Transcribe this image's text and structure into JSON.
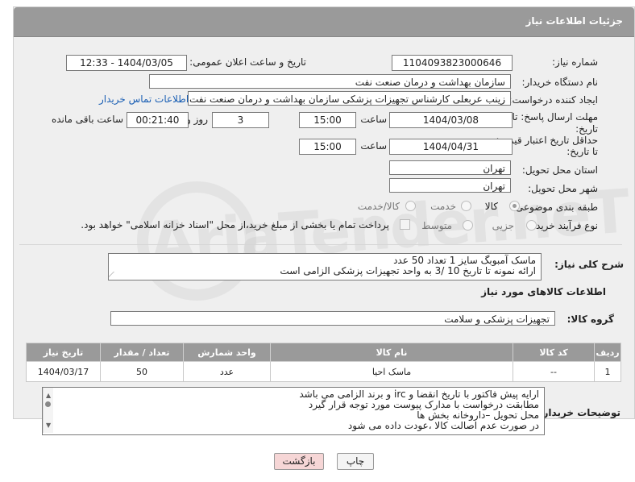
{
  "header": {
    "title": "جزئیات اطلاعات نیاز"
  },
  "fields": {
    "need_number_label": "شماره نیاز:",
    "need_number": "1104093823000646",
    "announce_label": "تاریخ و ساعت اعلان عمومی:",
    "announce_value": "1404/03/05 - 12:33",
    "buyer_org_label": "نام دستگاه خریدار:",
    "buyer_org": "سازمان بهداشت و درمان صنعت نفت",
    "creator_label": "ایجاد کننده درخواست:",
    "creator": "زینب عربعلی کارشناس تجهیزات پزشکی سازمان بهداشت و درمان صنعت نفت",
    "contact_link": "اطلاعات تماس خریدار",
    "deadline_label_1": "مهلت ارسال پاسخ: تا",
    "deadline_label_2": "تاریخ:",
    "deadline_date": "1404/03/08",
    "time_label": "ساعت",
    "deadline_time": "15:00",
    "days_value": "3",
    "days_label": "روز و",
    "remaining_time": "00:21:40",
    "remaining_label": "ساعت باقی مانده",
    "price_label_1": "حداقل تاریخ اعتبار قیمت:",
    "price_label_2": "تا تاریخ:",
    "price_date": "1404/04/31",
    "price_time": "15:00",
    "province_label": "استان محل تحویل:",
    "province": "تهران",
    "city_label": "شهر محل تحویل:",
    "city": "تهران",
    "category_label": "طبقه بندی موضوعی:",
    "category_options": [
      "کالا",
      "خدمت",
      "کالا/خدمت"
    ],
    "process_label": "نوع فرآیند خرید :",
    "process_options": [
      "جزیی",
      "متوسط"
    ],
    "payment_note": "پرداخت تمام یا بخشی از مبلغ خرید،از محل \"اسناد خزانه اسلامی\" خواهد بود."
  },
  "description": {
    "label": "شرح کلی نیاز:",
    "lines": [
      "ماسک آمبوبگ سایز 1 تعداد 50 عدد",
      "ارائه نمونه تا تاریخ 10 /3 به واحد تجهیزات پزشکی الزامی است"
    ]
  },
  "goods_section": {
    "title": "اطلاعات کالاهای مورد نیاز",
    "group_label": "گروه کالا:",
    "group_value": "تجهیزات پزشکی و سلامت"
  },
  "table": {
    "headers": [
      "ردیف",
      "کد کالا",
      "نام کالا",
      "واحد شمارش",
      "تعداد / مقدار",
      "تاریخ نیاز"
    ],
    "rows": [
      [
        "1",
        "--",
        "ماسک احیا",
        "عدد",
        "50",
        "1404/03/17"
      ]
    ]
  },
  "buyer_notes": {
    "label": "توضیحات خریدار:",
    "lines": [
      "ارایه  پیش فاکتور با تاریخ انقضا و irc  و برند الزامی می باشد",
      "مطابقت درخواست با مدارک پیوست مورد توجه قرار گیرد",
      "محل تحویل –داروخانه بخش ها",
      "در صورت عدم اصالت کالا ،عودت داده می شود"
    ]
  },
  "buttons": {
    "print": "چاپ",
    "back": "بازگشت"
  },
  "watermark": "AriaTender.neT",
  "colors": {
    "header_bg": "#9a9a9a",
    "link": "#1a5fb4",
    "back_btn_bg": "#f6d6d6"
  }
}
